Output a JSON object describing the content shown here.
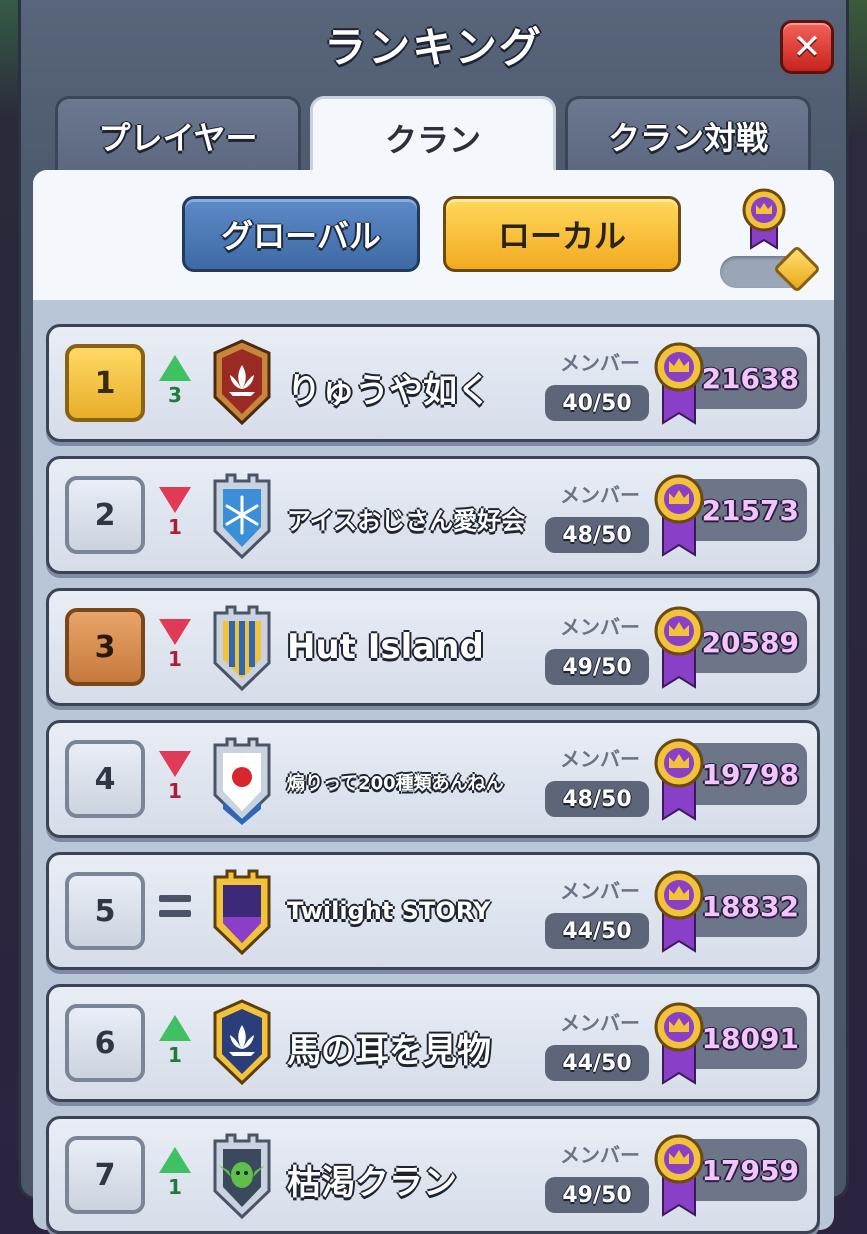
{
  "title": "ランキング",
  "close_icon": "close-icon",
  "tabs": [
    {
      "label": "プレイヤー",
      "active": false
    },
    {
      "label": "クラン",
      "active": true
    },
    {
      "label": "クラン対戦",
      "active": false
    }
  ],
  "scope": {
    "global_label": "グローバル",
    "local_label": "ローカル",
    "selected": "ローカル"
  },
  "member_label": "メンバー",
  "colors": {
    "trophy_text": "#f3c4ff",
    "up": "#3fc063",
    "down": "#e03a56"
  },
  "rows": [
    {
      "rank": "1",
      "trend": "up",
      "change": "3",
      "badge": "lotus-red-badge-icon",
      "name": "りゅうや如く",
      "members": "40/50",
      "trophies": "21638"
    },
    {
      "rank": "2",
      "trend": "down",
      "change": "1",
      "badge": "snowflake-badge-icon",
      "name": "アイスおじさん愛好会",
      "members": "48/50",
      "trophies": "21573"
    },
    {
      "rank": "3",
      "trend": "down",
      "change": "1",
      "badge": "striped-badge-icon",
      "name": "Hut Island",
      "members": "49/50",
      "trophies": "20589"
    },
    {
      "rank": "4",
      "trend": "down",
      "change": "1",
      "badge": "rising-sun-badge-icon",
      "name": "煽りって200種類あんねん",
      "members": "48/50",
      "trophies": "19798"
    },
    {
      "rank": "5",
      "trend": "same",
      "change": "",
      "badge": "moon-badge-icon",
      "name": "Twilight STORY",
      "members": "44/50",
      "trophies": "18832"
    },
    {
      "rank": "6",
      "trend": "up",
      "change": "1",
      "badge": "lotus-blue-badge-icon",
      "name": "馬の耳を見物",
      "members": "44/50",
      "trophies": "18091"
    },
    {
      "rank": "7",
      "trend": "up",
      "change": "1",
      "badge": "goblin-badge-icon",
      "name": "枯渇クラン",
      "members": "49/50",
      "trophies": "17959"
    }
  ]
}
